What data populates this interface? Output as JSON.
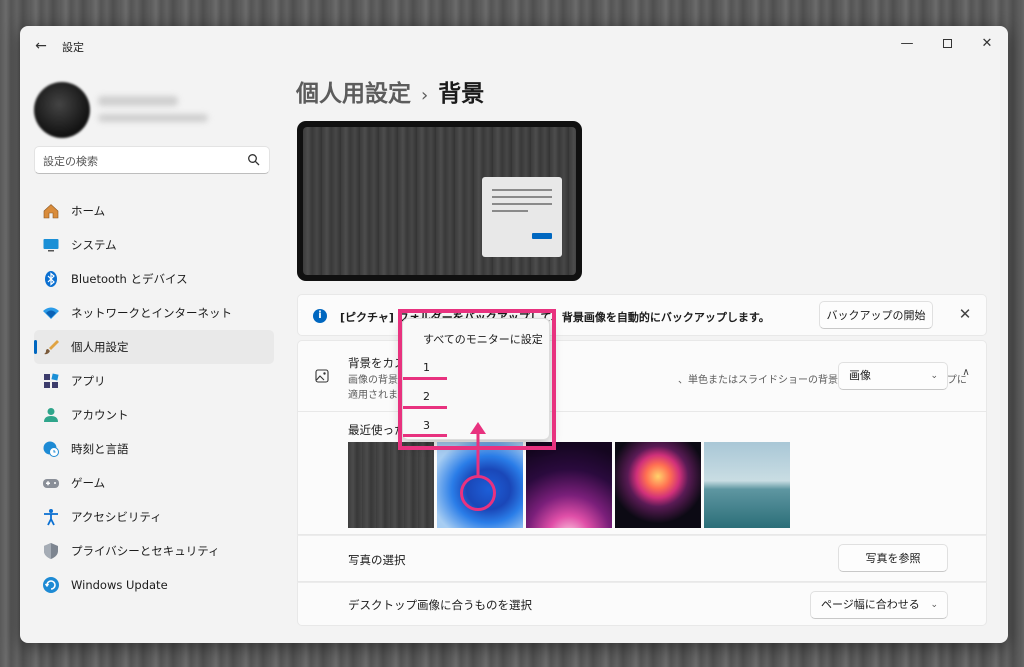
{
  "window": {
    "title": "設定"
  },
  "search": {
    "placeholder": "設定の検索"
  },
  "sidebar": {
    "items": [
      {
        "label": "ホーム",
        "icon": "home-icon",
        "active": false
      },
      {
        "label": "システム",
        "icon": "system-icon",
        "active": false
      },
      {
        "label": "Bluetooth とデバイス",
        "icon": "bluetooth-icon",
        "active": false
      },
      {
        "label": "ネットワークとインターネット",
        "icon": "network-icon",
        "active": false
      },
      {
        "label": "個人用設定",
        "icon": "personalization-icon",
        "active": true
      },
      {
        "label": "アプリ",
        "icon": "apps-icon",
        "active": false
      },
      {
        "label": "アカウント",
        "icon": "account-icon",
        "active": false
      },
      {
        "label": "時刻と言語",
        "icon": "time-language-icon",
        "active": false
      },
      {
        "label": "ゲーム",
        "icon": "gaming-icon",
        "active": false
      },
      {
        "label": "アクセシビリティ",
        "icon": "accessibility-icon",
        "active": false
      },
      {
        "label": "プライバシーとセキュリティ",
        "icon": "privacy-icon",
        "active": false
      },
      {
        "label": "Windows Update",
        "icon": "windows-update-icon",
        "active": false
      }
    ]
  },
  "breadcrumb": {
    "parent": "個人用設定",
    "separator": "›",
    "current": "背景"
  },
  "banner": {
    "text": "[ピクチャ] フォルダーをバックアップして、背景画像を自動的にバックアップします。",
    "button": "バックアップの開始"
  },
  "background_card": {
    "title": "背景をカスタマイズ",
    "desc_left": "画像の背景は",
    "desc_right": "、単色またはスライドショーの背景は、すべてのデスクトップに",
    "desc_line2": "適用されます",
    "select_value": "画像"
  },
  "recent": {
    "label": "最近使った画像"
  },
  "context_menu": {
    "items": [
      "すべてのモニターに設定",
      "1",
      "2",
      "3"
    ]
  },
  "photo_row": {
    "label": "写真の選択",
    "button": "写真を参照"
  },
  "fit_row": {
    "label": "デスクトップ画像に合うものを選択",
    "select_value": "ページ幅に合わせる"
  },
  "colors": {
    "accent": "#0067c0",
    "annotation": "#e8327f"
  }
}
